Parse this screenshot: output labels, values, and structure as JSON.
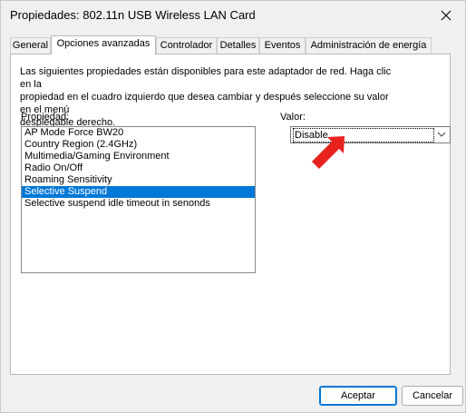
{
  "window": {
    "title": "Propiedades: 802.11n USB Wireless LAN Card"
  },
  "tabs": [
    {
      "label": "General"
    },
    {
      "label": "Opciones avanzadas"
    },
    {
      "label": "Controlador"
    },
    {
      "label": "Detalles"
    },
    {
      "label": "Eventos"
    },
    {
      "label": "Administración de energía"
    }
  ],
  "advanced": {
    "description_lines": [
      "Las siguientes propiedades están disponibles para este adaptador de red. Haga clic en la",
      "propiedad en el cuadro izquierdo que desea cambiar y después seleccione su valor en el menú",
      "desplegable derecho."
    ],
    "property_label": "Propiedad:",
    "value_label": "Valor:",
    "properties": [
      {
        "label": "AP Mode Force BW20"
      },
      {
        "label": "Country Region (2.4GHz)"
      },
      {
        "label": "Multimedia/Gaming Environment"
      },
      {
        "label": "Radio On/Off"
      },
      {
        "label": "Roaming Sensitivity"
      },
      {
        "label": "Selective Suspend"
      },
      {
        "label": "Selective suspend idle timeout in senonds"
      }
    ],
    "selected_property": "Selective Suspend",
    "value_selected": "Disable",
    "arrow_color": "#e8231f"
  },
  "buttons": {
    "accept": "Aceptar",
    "cancel": "Cancelar"
  },
  "colors": {
    "selection": "#0078d7"
  },
  "icons": {
    "close": "close-icon",
    "dropdown": "chevron-down-icon",
    "annotation": "red-arrow-icon"
  }
}
